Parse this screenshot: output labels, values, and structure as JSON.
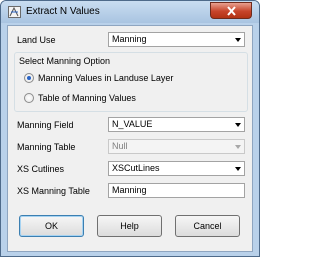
{
  "window": {
    "title": "Extract N Values",
    "close_icon": "close-icon",
    "app_icon": "extract-tool-icon"
  },
  "form": {
    "land_use": {
      "label": "Land Use",
      "value": "Manning"
    },
    "group": {
      "title": "Select Manning Option",
      "options": [
        {
          "label": "Manning Values in Landuse Layer",
          "checked": true
        },
        {
          "label": "Table of Manning Values",
          "checked": false
        }
      ]
    },
    "manning_field": {
      "label": "Manning Field",
      "value": "N_VALUE"
    },
    "manning_table": {
      "label": "Manning Table",
      "value": "Null",
      "disabled": true
    },
    "xs_cutlines": {
      "label": "XS Cutlines",
      "value": "XSCutLines"
    },
    "xs_manning_table": {
      "label": "XS Manning Table",
      "value": "Manning"
    }
  },
  "buttons": {
    "ok": "OK",
    "help": "Help",
    "cancel": "Cancel"
  },
  "colors": {
    "accent": "#2a64c5",
    "close_red": "#c7442b"
  }
}
